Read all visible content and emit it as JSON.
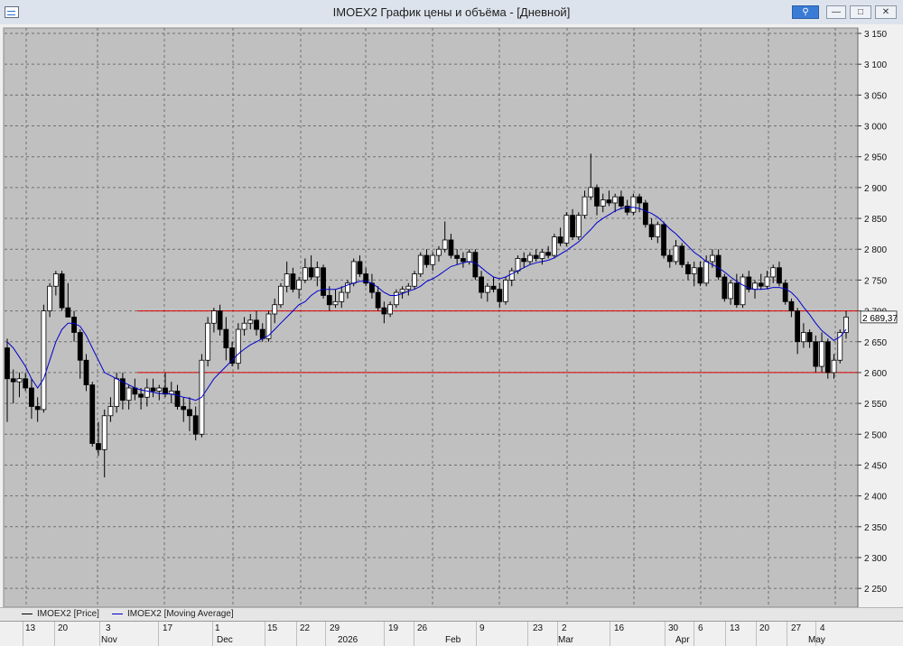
{
  "window": {
    "title": "IMOEX2 График цены и объёма - [Дневной]",
    "buttons": {
      "pin": "⚲",
      "minimize": "—",
      "maximize": "□",
      "close": "✕"
    }
  },
  "legend": [
    {
      "label": "IMOEX2 [Price]",
      "color": "#000000"
    },
    {
      "label": "IMOEX2 [Moving Average]",
      "color": "#0000cc"
    }
  ],
  "time_axis": {
    "days": [
      "13",
      "20",
      "3",
      "17",
      "1",
      "15",
      "22",
      "29",
      "19",
      "26",
      "9",
      "23",
      "2",
      "16",
      "30",
      "6",
      "13",
      "20",
      "27",
      "4"
    ],
    "months": [
      "Nov",
      "Dec",
      "2026",
      "Feb",
      "Mar",
      "Apr",
      "May"
    ]
  },
  "chart_data": {
    "type": "candlestick",
    "instrument": "IMOEX2",
    "ylim": [
      2200,
      3170
    ],
    "y_ticks": [
      "3 150",
      "3 100",
      "3 050",
      "3 000",
      "2 950",
      "2 900",
      "2 850",
      "2 800",
      "2 750",
      "2 700",
      "2 650",
      "2 600",
      "2 550",
      "2 500",
      "2 450",
      "2 400",
      "2 350",
      "2 300",
      "2 250"
    ],
    "last_price_label": "2 689,37",
    "grid": true,
    "horizontal_lines": [
      2700,
      2600
    ],
    "colors": {
      "up": "#ffffff",
      "down": "#000000",
      "ma": "#0000cc",
      "hline": "#dd0000",
      "plot_bg": "#c0c0c0"
    },
    "candles": [
      [
        2640,
        2655,
        2520,
        2590
      ],
      [
        2590,
        2605,
        2550,
        2585
      ],
      [
        2585,
        2600,
        2560,
        2590
      ],
      [
        2590,
        2600,
        2570,
        2575
      ],
      [
        2575,
        2590,
        2525,
        2545
      ],
      [
        2545,
        2560,
        2520,
        2540
      ],
      [
        2540,
        2710,
        2535,
        2700
      ],
      [
        2700,
        2745,
        2690,
        2740
      ],
      [
        2740,
        2765,
        2725,
        2760
      ],
      [
        2760,
        2765,
        2700,
        2705
      ],
      [
        2705,
        2745,
        2690,
        2690
      ],
      [
        2690,
        2700,
        2650,
        2665
      ],
      [
        2665,
        2670,
        2590,
        2620
      ],
      [
        2620,
        2630,
        2570,
        2580
      ],
      [
        2580,
        2585,
        2480,
        2485
      ],
      [
        2485,
        2520,
        2465,
        2475
      ],
      [
        2475,
        2540,
        2430,
        2530
      ],
      [
        2530,
        2560,
        2520,
        2545
      ],
      [
        2545,
        2600,
        2535,
        2590
      ],
      [
        2590,
        2600,
        2540,
        2555
      ],
      [
        2555,
        2580,
        2540,
        2575
      ],
      [
        2575,
        2590,
        2555,
        2565
      ],
      [
        2565,
        2575,
        2540,
        2560
      ],
      [
        2560,
        2590,
        2545,
        2575
      ],
      [
        2575,
        2590,
        2560,
        2570
      ],
      [
        2570,
        2580,
        2555,
        2575
      ],
      [
        2575,
        2600,
        2560,
        2565
      ],
      [
        2565,
        2585,
        2550,
        2570
      ],
      [
        2570,
        2580,
        2540,
        2545
      ],
      [
        2545,
        2560,
        2520,
        2540
      ],
      [
        2540,
        2560,
        2505,
        2530
      ],
      [
        2530,
        2545,
        2490,
        2500
      ],
      [
        2500,
        2630,
        2495,
        2620
      ],
      [
        2620,
        2690,
        2610,
        2680
      ],
      [
        2680,
        2705,
        2665,
        2700
      ],
      [
        2700,
        2710,
        2660,
        2670
      ],
      [
        2670,
        2690,
        2620,
        2640
      ],
      [
        2640,
        2650,
        2610,
        2615
      ],
      [
        2615,
        2680,
        2605,
        2670
      ],
      [
        2670,
        2690,
        2660,
        2680
      ],
      [
        2680,
        2695,
        2670,
        2685
      ],
      [
        2685,
        2700,
        2660,
        2670
      ],
      [
        2670,
        2680,
        2650,
        2655
      ],
      [
        2655,
        2700,
        2650,
        2695
      ],
      [
        2695,
        2720,
        2680,
        2710
      ],
      [
        2710,
        2745,
        2705,
        2740
      ],
      [
        2740,
        2780,
        2730,
        2760
      ],
      [
        2760,
        2770,
        2730,
        2735
      ],
      [
        2735,
        2755,
        2720,
        2750
      ],
      [
        2750,
        2785,
        2745,
        2770
      ],
      [
        2770,
        2790,
        2750,
        2755
      ],
      [
        2755,
        2780,
        2740,
        2770
      ],
      [
        2770,
        2775,
        2720,
        2725
      ],
      [
        2725,
        2740,
        2700,
        2710
      ],
      [
        2710,
        2735,
        2705,
        2715
      ],
      [
        2715,
        2740,
        2705,
        2730
      ],
      [
        2730,
        2750,
        2720,
        2745
      ],
      [
        2745,
        2785,
        2740,
        2780
      ],
      [
        2780,
        2790,
        2755,
        2760
      ],
      [
        2760,
        2770,
        2740,
        2745
      ],
      [
        2745,
        2760,
        2720,
        2730
      ],
      [
        2730,
        2740,
        2700,
        2705
      ],
      [
        2705,
        2715,
        2680,
        2695
      ],
      [
        2695,
        2715,
        2690,
        2710
      ],
      [
        2710,
        2735,
        2705,
        2730
      ],
      [
        2730,
        2740,
        2720,
        2735
      ],
      [
        2735,
        2745,
        2725,
        2740
      ],
      [
        2740,
        2765,
        2735,
        2760
      ],
      [
        2760,
        2795,
        2755,
        2790
      ],
      [
        2790,
        2800,
        2770,
        2775
      ],
      [
        2775,
        2795,
        2765,
        2790
      ],
      [
        2790,
        2805,
        2780,
        2800
      ],
      [
        2800,
        2845,
        2795,
        2815
      ],
      [
        2815,
        2825,
        2785,
        2790
      ],
      [
        2790,
        2800,
        2775,
        2785
      ],
      [
        2785,
        2795,
        2770,
        2780
      ],
      [
        2780,
        2800,
        2775,
        2795
      ],
      [
        2795,
        2800,
        2750,
        2755
      ],
      [
        2755,
        2765,
        2720,
        2730
      ],
      [
        2730,
        2745,
        2715,
        2740
      ],
      [
        2740,
        2755,
        2730,
        2735
      ],
      [
        2735,
        2745,
        2705,
        2715
      ],
      [
        2715,
        2755,
        2710,
        2750
      ],
      [
        2750,
        2770,
        2740,
        2765
      ],
      [
        2765,
        2790,
        2760,
        2785
      ],
      [
        2785,
        2795,
        2770,
        2780
      ],
      [
        2780,
        2795,
        2775,
        2790
      ],
      [
        2790,
        2800,
        2780,
        2785
      ],
      [
        2785,
        2800,
        2775,
        2795
      ],
      [
        2795,
        2805,
        2785,
        2790
      ],
      [
        2790,
        2825,
        2785,
        2820
      ],
      [
        2820,
        2835,
        2805,
        2810
      ],
      [
        2810,
        2860,
        2805,
        2855
      ],
      [
        2855,
        2865,
        2815,
        2820
      ],
      [
        2820,
        2860,
        2815,
        2855
      ],
      [
        2855,
        2895,
        2850,
        2885
      ],
      [
        2885,
        2955,
        2880,
        2900
      ],
      [
        2900,
        2905,
        2855,
        2870
      ],
      [
        2870,
        2890,
        2860,
        2880
      ],
      [
        2880,
        2895,
        2870,
        2875
      ],
      [
        2875,
        2890,
        2860,
        2885
      ],
      [
        2885,
        2895,
        2865,
        2870
      ],
      [
        2870,
        2880,
        2855,
        2860
      ],
      [
        2860,
        2890,
        2855,
        2885
      ],
      [
        2885,
        2890,
        2860,
        2875
      ],
      [
        2875,
        2880,
        2835,
        2840
      ],
      [
        2840,
        2850,
        2815,
        2820
      ],
      [
        2820,
        2845,
        2810,
        2840
      ],
      [
        2840,
        2845,
        2785,
        2790
      ],
      [
        2790,
        2800,
        2770,
        2780
      ],
      [
        2780,
        2815,
        2775,
        2805
      ],
      [
        2805,
        2810,
        2770,
        2775
      ],
      [
        2775,
        2780,
        2750,
        2760
      ],
      [
        2760,
        2780,
        2740,
        2770
      ],
      [
        2770,
        2780,
        2740,
        2745
      ],
      [
        2745,
        2790,
        2740,
        2780
      ],
      [
        2780,
        2800,
        2770,
        2790
      ],
      [
        2790,
        2800,
        2750,
        2755
      ],
      [
        2755,
        2760,
        2715,
        2720
      ],
      [
        2720,
        2750,
        2710,
        2745
      ],
      [
        2745,
        2760,
        2705,
        2710
      ],
      [
        2710,
        2760,
        2705,
        2755
      ],
      [
        2755,
        2765,
        2730,
        2735
      ],
      [
        2735,
        2750,
        2720,
        2745
      ],
      [
        2745,
        2760,
        2735,
        2740
      ],
      [
        2740,
        2765,
        2735,
        2755
      ],
      [
        2755,
        2775,
        2745,
        2770
      ],
      [
        2770,
        2780,
        2740,
        2745
      ],
      [
        2745,
        2750,
        2710,
        2715
      ],
      [
        2715,
        2720,
        2690,
        2700
      ],
      [
        2700,
        2705,
        2630,
        2650
      ],
      [
        2650,
        2680,
        2640,
        2665
      ],
      [
        2665,
        2670,
        2640,
        2650
      ],
      [
        2650,
        2660,
        2600,
        2610
      ],
      [
        2610,
        2665,
        2600,
        2650
      ],
      [
        2650,
        2655,
        2590,
        2600
      ],
      [
        2600,
        2630,
        2590,
        2620
      ],
      [
        2620,
        2670,
        2615,
        2665
      ],
      [
        2665,
        2700,
        2655,
        2690
      ]
    ],
    "moving_average": [
      2650,
      2640,
      2625,
      2610,
      2590,
      2575,
      2590,
      2620,
      2650,
      2670,
      2680,
      2680,
      2675,
      2660,
      2640,
      2620,
      2600,
      2595,
      2590,
      2585,
      2580,
      2575,
      2572,
      2570,
      2568,
      2566,
      2566,
      2565,
      2563,
      2560,
      2558,
      2555,
      2560,
      2575,
      2590,
      2600,
      2610,
      2620,
      2630,
      2638,
      2645,
      2650,
      2655,
      2660,
      2670,
      2680,
      2690,
      2700,
      2710,
      2715,
      2725,
      2732,
      2735,
      2735,
      2735,
      2738,
      2742,
      2745,
      2748,
      2748,
      2745,
      2738,
      2730,
      2725,
      2725,
      2728,
      2732,
      2735,
      2740,
      2748,
      2752,
      2758,
      2765,
      2772,
      2775,
      2778,
      2780,
      2778,
      2770,
      2762,
      2755,
      2752,
      2755,
      2760,
      2765,
      2770,
      2775,
      2778,
      2780,
      2782,
      2786,
      2792,
      2798,
      2805,
      2812,
      2822,
      2832,
      2843,
      2850,
      2856,
      2862,
      2866,
      2868,
      2868,
      2866,
      2862,
      2858,
      2852,
      2843,
      2833,
      2825,
      2815,
      2805,
      2795,
      2788,
      2780,
      2775,
      2770,
      2763,
      2755,
      2748,
      2742,
      2737,
      2735,
      2735,
      2736,
      2738,
      2738,
      2736,
      2730,
      2720,
      2706,
      2694,
      2680,
      2668,
      2660,
      2652,
      2658,
      2670
    ]
  }
}
